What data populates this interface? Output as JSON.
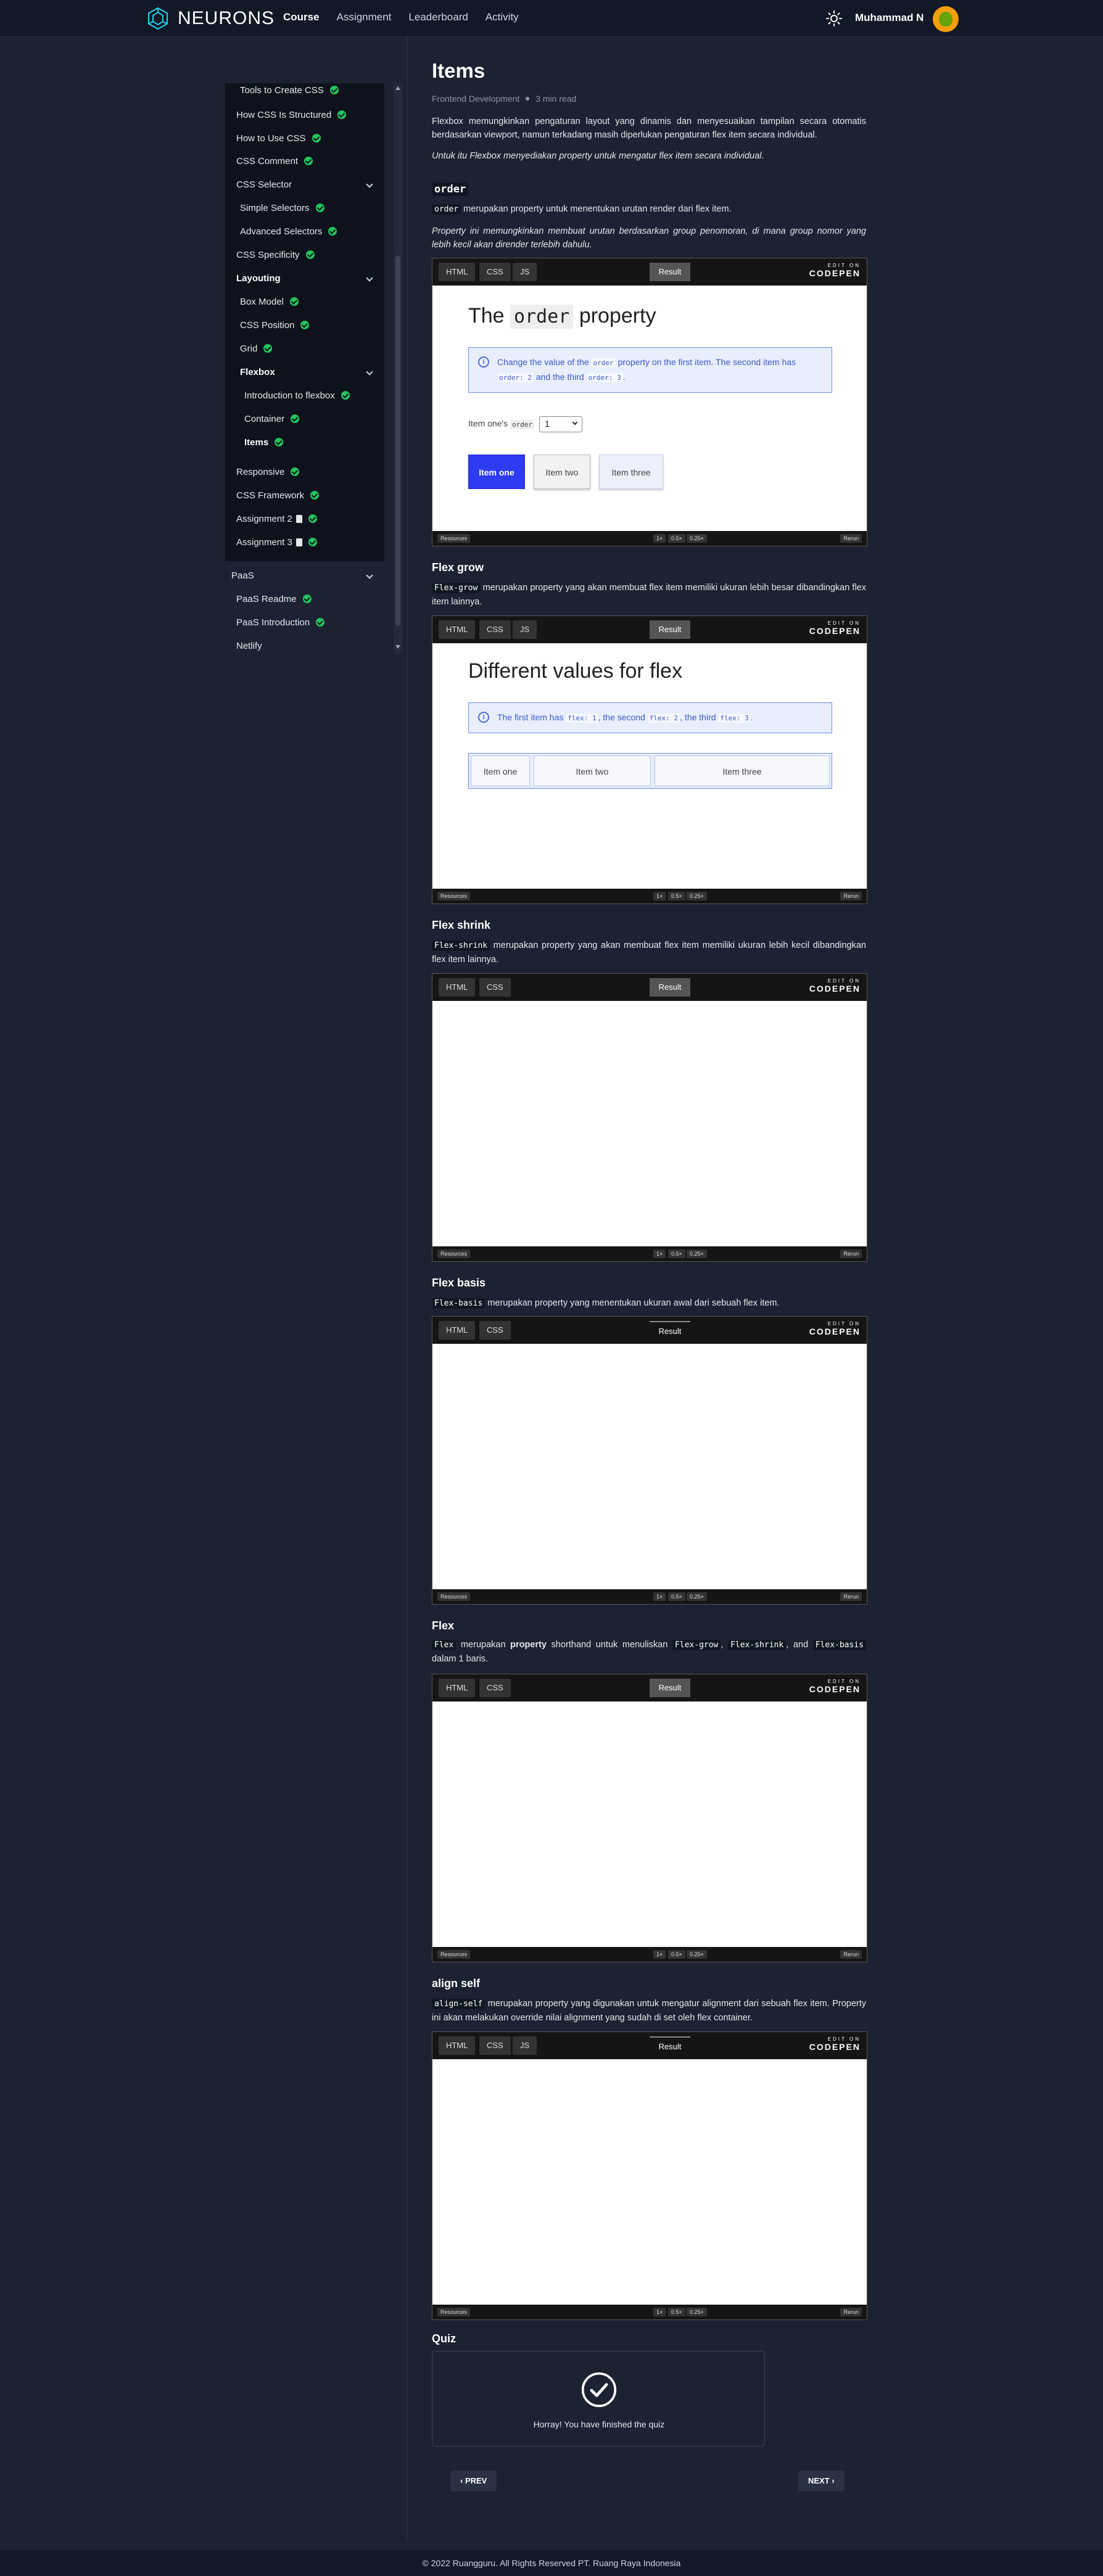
{
  "header": {
    "brand": "NEURONS",
    "menu": [
      "Course",
      "Assignment",
      "Leaderboard",
      "Activity"
    ],
    "user_name": "Muhammad N"
  },
  "sidebar": {
    "items": [
      {
        "label": "Tools to Create CSS"
      },
      {
        "label": "How CSS Is Structured"
      },
      {
        "label": "How to Use CSS"
      },
      {
        "label": "CSS Comment"
      },
      {
        "label": "CSS Selector"
      },
      {
        "label": "Simple Selectors"
      },
      {
        "label": "Advanced Selectors"
      },
      {
        "label": "CSS Specificity"
      },
      {
        "label": "Layouting"
      },
      {
        "label": "Box Model"
      },
      {
        "label": "CSS Position"
      },
      {
        "label": "Grid"
      },
      {
        "label": "Flexbox"
      },
      {
        "label": "Introduction to flexbox"
      },
      {
        "label": "Container"
      },
      {
        "label": "Items"
      },
      {
        "label": "Responsive"
      },
      {
        "label": "CSS Framework"
      },
      {
        "label": "Assignment 2"
      },
      {
        "label": "Assignment 3"
      },
      {
        "label": "PaaS"
      },
      {
        "label": "PaaS Readme"
      },
      {
        "label": "PaaS Introduction"
      },
      {
        "label": "Netlify"
      }
    ]
  },
  "page": {
    "title": "Items",
    "category": "Frontend Development",
    "read_time": "3 min read",
    "intro_1": "Flexbox memungkinkan pengaturan layout yang dinamis dan menyesuaikan tampilan secara otomatis berdasarkan viewport, namun terkadang masih diperlukan pengaturan flex item secara individual.",
    "intro_2": "Untuk itu Flexbox menyediakan property untuk mengatur flex item secara individual."
  },
  "sections": {
    "order": {
      "title": "order",
      "code": "order",
      "desc": "merupakan property untuk menentukan urutan render dari flex item.",
      "desc2": "Property ini memungkinkan membuat urutan berdasarkan group penomoran, di mana group nomor yang lebih kecil akan dirender terlebih dahulu."
    },
    "grow": {
      "title": "Flex grow",
      "code": "Flex-grow",
      "desc": "merupakan property yang akan membuat flex item memiliki ukuran lebih besar dibandingkan flex item lainnya."
    },
    "shrink": {
      "title": "Flex shrink",
      "code": "Flex-shrink",
      "desc": "merupakan property yang akan membuat flex item memiliki ukuran lebih kecil dibandingkan flex item lainnya."
    },
    "basis": {
      "title": "Flex basis",
      "code": "Flex-basis",
      "desc": "merupakan property yang menentukan ukuran awal dari sebuah flex item."
    },
    "flex": {
      "title": "Flex",
      "code": "Flex",
      "desc_a": "merupakan",
      "desc_b": "property",
      "desc_c": "shorthand untuk menuliskan",
      "c1": "Flex-grow",
      "c2": "Flex-shrink",
      "c3": "Flex-basis",
      "desc_d": "dalam 1 baris.",
      "and": ", and"
    },
    "alignself": {
      "title": "align self",
      "code": "align-self",
      "desc": "merupakan property yang digunakan untuk mengatur alignment dari sebuah flex item. Property ini akan melakukan override nilai alignment yang sudah di set oleh flex container."
    }
  },
  "codepen": {
    "tabs_html": "HTML",
    "tabs_css": "CSS",
    "tabs_js": "JS",
    "result": "Result",
    "edit_on": "EDIT ON",
    "brand": "CODEPEN",
    "resources": "Resources",
    "z1": "1×",
    "z2": "0.5×",
    "z3": "0.25×",
    "rerun": "Rerun"
  },
  "demo_order": {
    "heading_a": "The",
    "heading_code": "order",
    "heading_b": "property",
    "note_a": "Change the value of the",
    "note_c1": "order",
    "note_b": "property on the first item. The second item has",
    "note_c2": "order: 2",
    "note_d": "and the third",
    "note_c3": "order: 3",
    "label_a": "Item one's",
    "label_code": "order",
    "select_value": "1",
    "items": [
      "Item one",
      "Item two",
      "Item three"
    ]
  },
  "demo_grow": {
    "heading": "Different values for flex",
    "note_a": "The first item has",
    "note_c1": "flex: 1",
    "note_b": ", the second",
    "note_c2": "flex: 2",
    "note_d": ", the third",
    "note_c3": "flex: 3",
    "items": [
      "Item one",
      "Item two",
      "Item three"
    ],
    "flex_values": [
      1,
      2,
      3
    ]
  },
  "quiz": {
    "title": "Quiz",
    "message": "Horray! You have finished the quiz"
  },
  "pager": {
    "prev": "‹ PREV",
    "next": "NEXT ›"
  },
  "footer": "© 2022 Ruangguru. All Rights Reserved PT. Ruang Raya Indonesia"
}
